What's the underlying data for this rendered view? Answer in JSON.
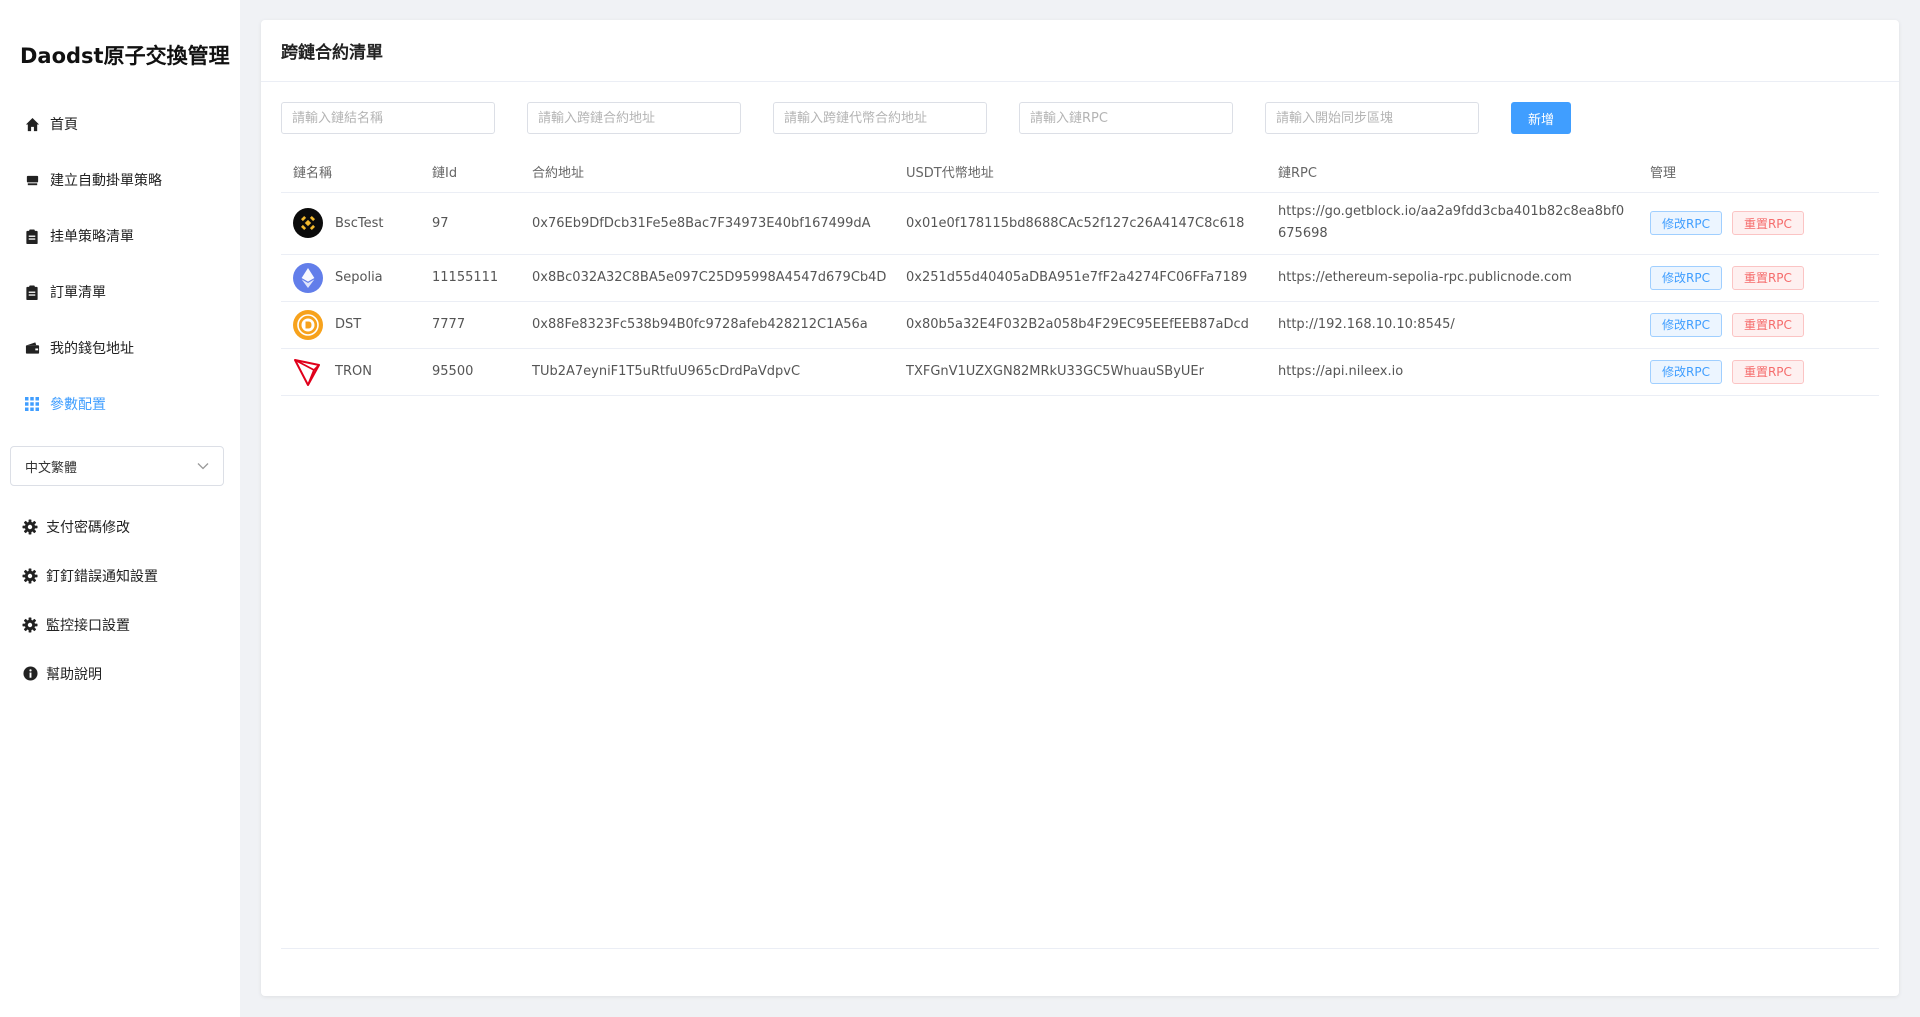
{
  "brand": "Daodst原子交換管理",
  "nav": [
    {
      "label": "首頁",
      "icon": "home-icon"
    },
    {
      "label": "建立自動掛單策略",
      "icon": "store-icon"
    },
    {
      "label": "挂单策略清單",
      "icon": "clipboard-icon"
    },
    {
      "label": "訂單清單",
      "icon": "clipboard-icon"
    },
    {
      "label": "我的錢包地址",
      "icon": "wallet-icon"
    },
    {
      "label": "參數配置",
      "icon": "grid-icon"
    }
  ],
  "language": {
    "selected": "中文繁體"
  },
  "settings": [
    {
      "label": "支付密碼修改",
      "icon": "gear-icon"
    },
    {
      "label": "釘釘錯誤通知設置",
      "icon": "gear-icon"
    },
    {
      "label": "監控接口設置",
      "icon": "gear-icon"
    },
    {
      "label": "幫助說明",
      "icon": "info-icon"
    }
  ],
  "page": {
    "title": "跨鏈合約清單"
  },
  "filters": {
    "chain_name_placeholder": "請輸入鏈結名稱",
    "contract_placeholder": "請輸入跨鏈合約地址",
    "token_placeholder": "請輸入跨鏈代幣合約地址",
    "rpc_placeholder": "請輸入鏈RPC",
    "block_placeholder": "請輸入開始同步區塊",
    "add_label": "新增"
  },
  "table": {
    "headers": {
      "name": "鏈名稱",
      "id": "鏈Id",
      "contract": "合約地址",
      "usdt": "USDT代幣地址",
      "rpc": "鏈RPC",
      "manage": "管理"
    },
    "rows": [
      {
        "name": "BscTest",
        "logo": "bnb-logo-icon",
        "id": "97",
        "contract": "0x76Eb9DfDcb31Fe5e8Bac7F34973E40bf167499dA",
        "usdt": "0x01e0f178115bd8688CAc52f127c26A4147C8c618",
        "rpc": "https://go.getblock.io/aa2a9fdd3cba401b82c8ea8bf0675698"
      },
      {
        "name": "Sepolia",
        "logo": "ethereum-logo-icon",
        "id": "11155111",
        "contract": "0x8Bc032A32C8BA5e097C25D95998A4547d679Cb4D",
        "usdt": "0x251d55d40405aDBA951e7fF2a4274FC06FFa7189",
        "rpc": "https://ethereum-sepolia-rpc.publicnode.com"
      },
      {
        "name": "DST",
        "logo": "dst-logo-icon",
        "id": "7777",
        "contract": "0x88Fe8323Fc538b94B0fc9728afeb428212C1A56a",
        "usdt": "0x80b5a32E4F032B2a058b4F29EC95EEfEEB87aDcd",
        "rpc": "http://192.168.10.10:8545/"
      },
      {
        "name": "TRON",
        "logo": "tron-logo-icon",
        "id": "95500",
        "contract": "TUb2A7eyniF1T5uRtfuU965cDrdPaVdpvC",
        "usdt": "TXFGnV1UZXGN82MRkU33GC5WhuauSByUEr",
        "rpc": "https://api.nileex.io"
      }
    ],
    "edit_label": "修改RPC",
    "reset_label": "重置RPC"
  },
  "colors": {
    "accent": "#409eff",
    "danger": "#f56c6c"
  }
}
